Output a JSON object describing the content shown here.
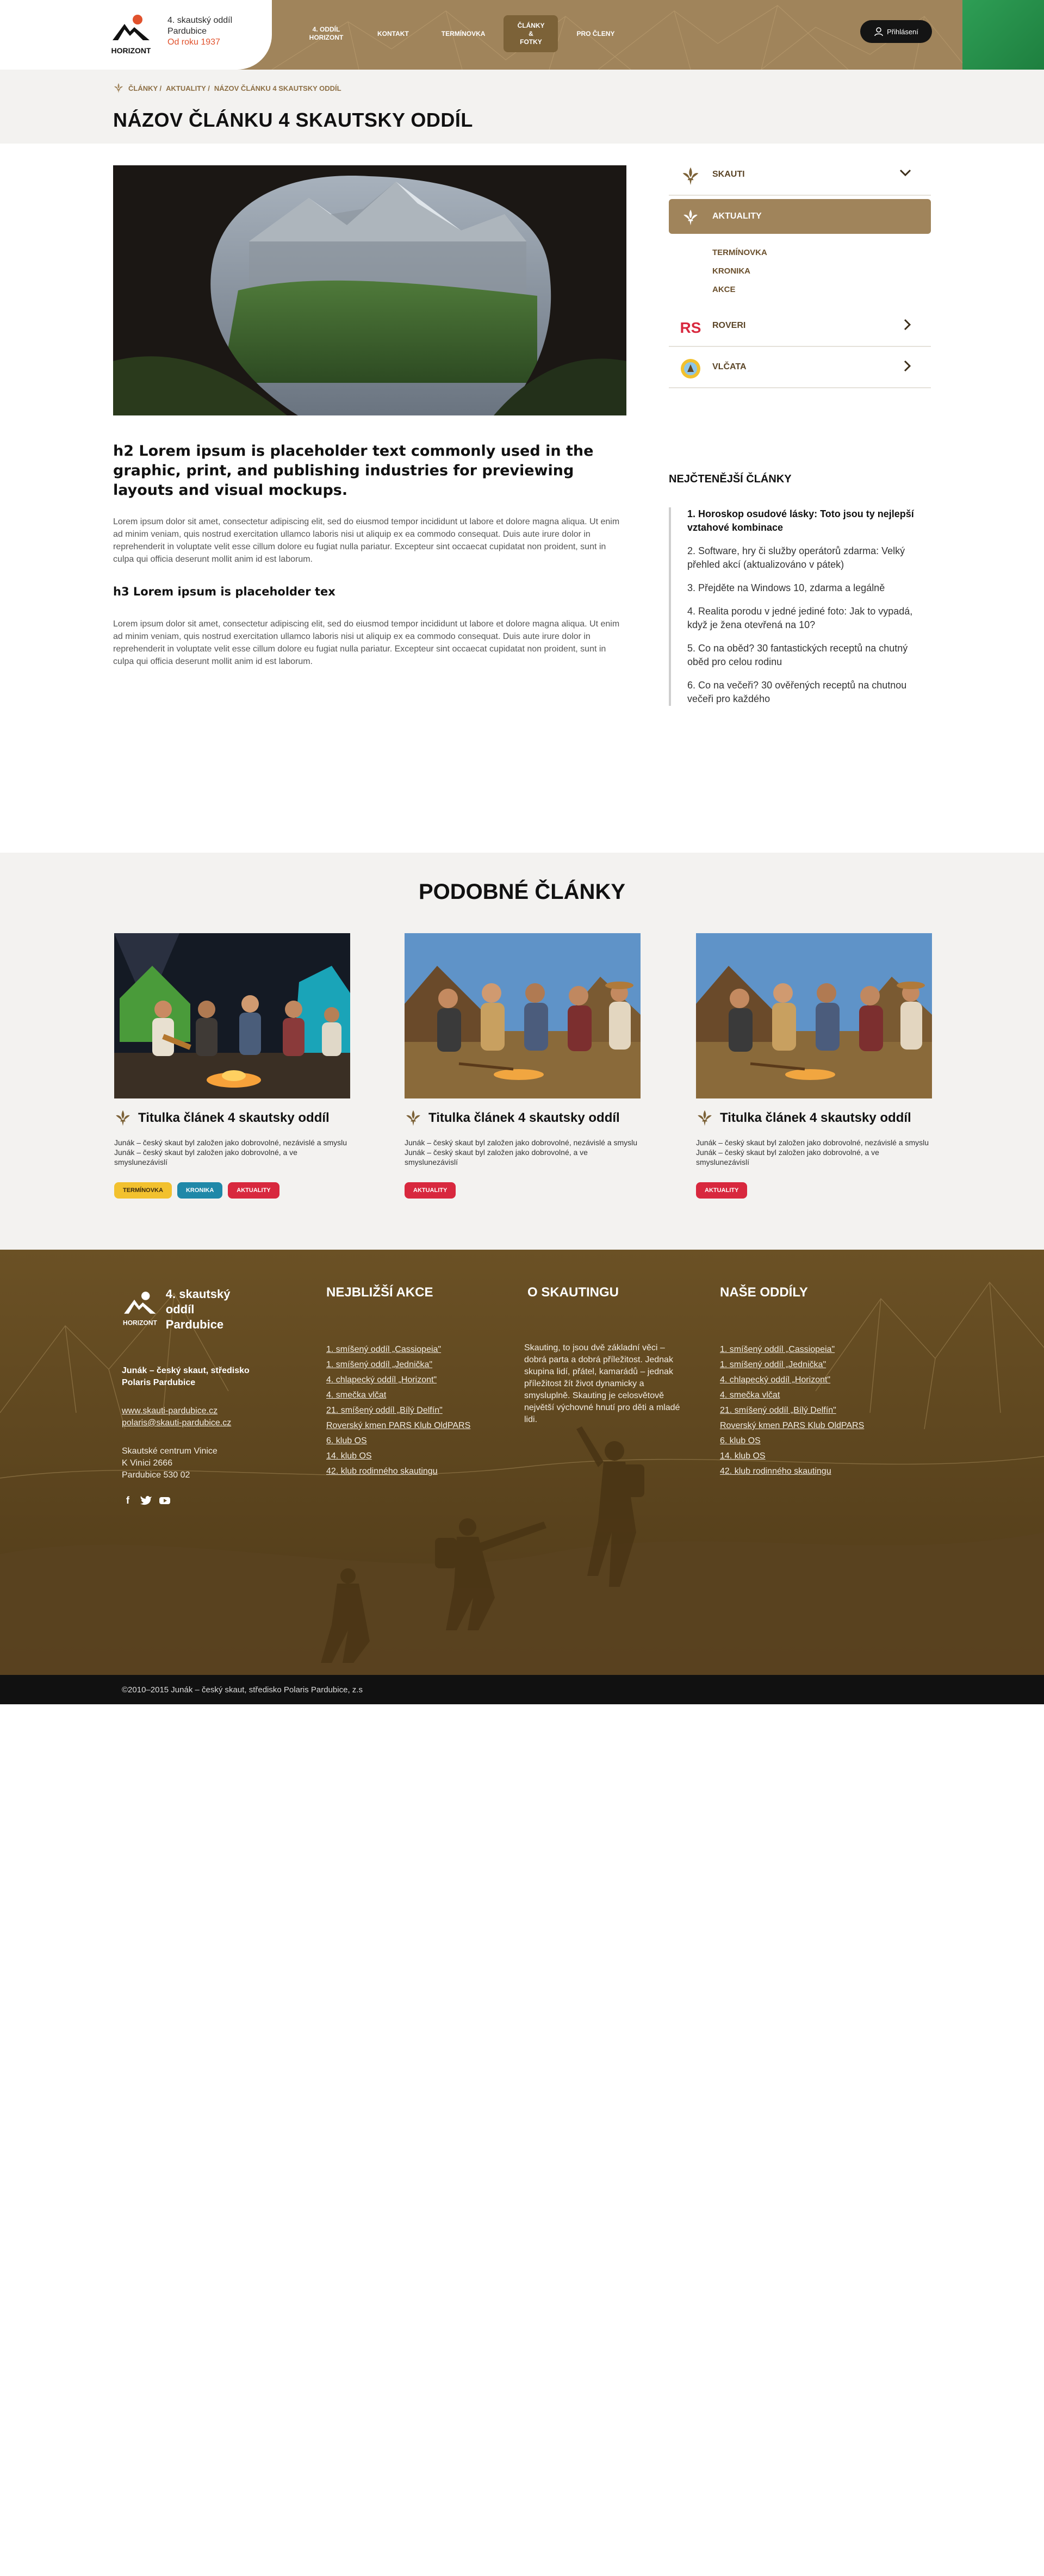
{
  "header": {
    "logo_word": "HORIZONT",
    "org_line1": "4. skautský oddíl",
    "org_line2": "Pardubice",
    "since": "Od roku 1937",
    "nav": [
      {
        "label": "4. oddíl Horizont",
        "active": false
      },
      {
        "label": "Kontakt",
        "active": false
      },
      {
        "label": "Termínovka",
        "active": false
      },
      {
        "label": "Články & fotky",
        "active": true
      },
      {
        "label": "Pro členy",
        "active": false
      }
    ],
    "login_label": "Přihlásení"
  },
  "breadcrumb": {
    "items": [
      "Články /",
      "Aktuality /",
      "Názov článku 4 skautsky oddíl"
    ]
  },
  "page_title": "Názov článku 4 skautsky oddíl",
  "article": {
    "h2": "h2  Lorem ipsum is placeholder text commonly used in the graphic, print, and publishing industries for previewing layouts and visual mockups.",
    "p1": "Lorem ipsum dolor sit amet, consectetur adipiscing elit, sed do eiusmod tempor incididunt ut labore et dolore magna aliqua. Ut enim ad minim veniam, quis nostrud exercitation ullamco laboris nisi ut aliquip ex ea commodo consequat. Duis aute irure dolor in reprehenderit in voluptate velit esse cillum dolore eu fugiat nulla pariatur. Excepteur sint occaecat cupidatat non proident, sunt in culpa qui officia deserunt mollit anim id est laborum.",
    "h3": "h3  Lorem ipsum is placeholder tex",
    "p2": "Lorem ipsum dolor sit amet, consectetur adipiscing elit, sed do eiusmod tempor incididunt ut labore et dolore magna aliqua. Ut enim ad minim veniam, quis nostrud exercitation ullamco laboris nisi ut aliquip ex ea commodo consequat. Duis aute irure dolor in reprehenderit in voluptate velit esse cillum dolore eu fugiat nulla pariatur. Excepteur sint occaecat cupidatat non proident, sunt in culpa qui officia deserunt mollit anim id est laborum."
  },
  "sidebar": {
    "items": [
      {
        "label": "Skauti",
        "icon": "fleur-de-lis-icon"
      },
      {
        "label": "Aktuality",
        "icon": "fleur-de-lis-icon",
        "active": true
      },
      {
        "label": "Roveri",
        "icon": "rs-logo-icon"
      },
      {
        "label": "Vlčata",
        "icon": "wolf-cub-badge-icon"
      }
    ],
    "subitems": [
      "Termínovka",
      "Kronika",
      "Akce"
    ]
  },
  "popular": {
    "title": "Nejčtenější články",
    "items": [
      "1. Horoskop osudové lásky: Toto jsou ty nejlepší vztahové kombinace",
      "2. Software, hry či služby operátorů zdarma: Velký přehled akcí (aktualizováno v pátek)",
      "3.  Přejděte na Windows 10, zdarma a legálně",
      "4. Realita porodu v jedné jediné foto: Jak to vypadá, když je žena otevřená na 10?",
      "5. Co na oběd? 30 fantastických receptů na chutný oběd pro celou rodinu",
      "6. Co na večeři? 30 ověřených receptů na chutnou večeři pro každého"
    ]
  },
  "related": {
    "title": "Podobné články",
    "cards": [
      {
        "title": "Titulka článek 4 skautsky oddíl",
        "desc": "Junák – český skaut byl založen jako dobrovolné, nezávislé a smyslu Junák – český skaut byl založen jako dobrovolné, a ve smyslunezávislí",
        "tags": [
          "Termínovka",
          "Kronika",
          "Aktuality"
        ]
      },
      {
        "title": "Titulka článek 4 skautsky oddíl",
        "desc": "Junák – český skaut byl založen jako dobrovolné, nezávislé a smyslu Junák – český skaut byl založen jako dobrovolné, a ve smyslunezávislí",
        "tags": [
          "Aktuality"
        ]
      },
      {
        "title": "Titulka článek 4 skautsky oddíl",
        "desc": "Junák – český skaut byl založen jako dobrovolné, nezávislé a smyslu Junák – český skaut byl založen jako dobrovolné, a ve smyslunezávislí",
        "tags": [
          "Aktuality"
        ]
      }
    ],
    "tag_colors": {
      "Termínovka": "#f2c12e",
      "Kronika": "#1f88a8",
      "Aktuality": "#d8283e"
    }
  },
  "footer": {
    "org_line1": "4. skautský oddíl",
    "org_line2": "Pardubice",
    "logo_word": "HORIZONT",
    "junak": "Junák – český skaut, středisko Polaris Pardubice",
    "web": "www.skauti-pardubice.cz",
    "email": "polaris@skauti-pardubice.cz",
    "address": [
      "Skautské centrum Vinice",
      "K Vinici 2666",
      "Pardubice 530 02"
    ],
    "social": [
      "facebook-icon",
      "twitter-icon",
      "youtube-icon"
    ],
    "events_title": "Nejbližší akce",
    "events": [
      "1. smíšený oddíl „Cassiopeia\"",
      "1. smíšený oddíl „Jednička\"",
      "4. chlapecký oddíl „Horizont\"",
      "4. smečka vlčat",
      "21. smíšený oddíl „Bílý Delfín\"",
      "Roverský kmen PARS Klub OldPARS",
      "6. klub OS",
      "14. klub OS",
      "42. klub rodinného skautingu"
    ],
    "about_title": "O skautingu",
    "about_text": "Skauting, to jsou dvě základní věci – dobrá parta a dobrá příležitost. Jednak skupina lidí, přátel, kamarádů – jednak příležitost žít život dynamicky a smysluplně. Skauting je celosvětově největší výchovné hnutí pro děti a mladé lidi.",
    "units_title": "Naše oddíly",
    "units": [
      "1. smíšený oddíl „Cassiopeia\"",
      "1. smíšený oddíl „Jednička\"",
      "4. chlapecký oddíl „Horizont\"",
      "4. smečka vlčat",
      "21. smíšený oddíl „Bílý Delfín\"",
      "Roverský kmen PARS Klub OldPARS",
      "6. klub OS",
      "14. klub OS",
      "42. klub rodinného skautingu"
    ],
    "copyright": "©2010–2015 Junák – český skaut, středisko Polaris Pardubice, z.s"
  }
}
